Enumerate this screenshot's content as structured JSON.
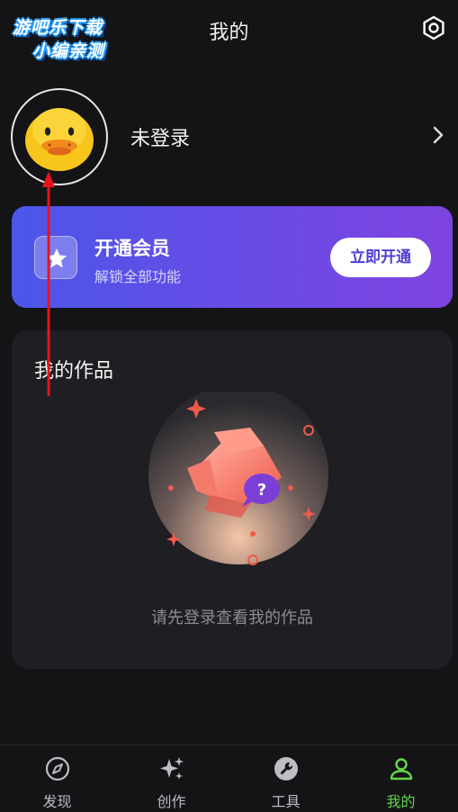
{
  "watermark": {
    "line1": "游吧乐下载",
    "line2": "小编亲测"
  },
  "header": {
    "title": "我的",
    "settings_icon": "gear-icon"
  },
  "profile": {
    "avatar_icon": "duck-avatar",
    "login_status": "未登录",
    "arrow_icon": "chevron-right-icon"
  },
  "vip": {
    "title": "开通会员",
    "subtitle": "解锁全部功能",
    "button_label": "立即开通",
    "icon": "star-icon",
    "colors": {
      "gradient_start": "#4b56e8",
      "gradient_end": "#7e44e0"
    }
  },
  "works": {
    "title": "我的作品",
    "empty_message": "请先登录查看我的作品",
    "illustration": "empty-works-illustration"
  },
  "tabbar": {
    "active_color": "#63d64a",
    "items": [
      {
        "label": "发现",
        "icon": "compass-icon",
        "active": false
      },
      {
        "label": "创作",
        "icon": "sparkle-icon",
        "active": false
      },
      {
        "label": "工具",
        "icon": "wrench-icon",
        "active": false
      },
      {
        "label": "我的",
        "icon": "user-icon",
        "active": true
      }
    ]
  }
}
